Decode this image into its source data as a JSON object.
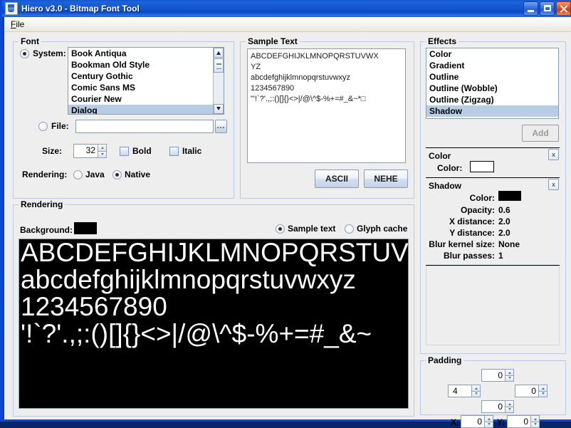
{
  "window": {
    "title": "Hiero v3.0 - Bitmap Font Tool",
    "icon": "java-cup-icon",
    "minimize_label": "",
    "maximize_label": "",
    "close_label": ""
  },
  "menubar": {
    "items": [
      {
        "label": "File",
        "mnemonic": "F"
      }
    ]
  },
  "font_panel": {
    "title": "Font",
    "system_label": "System:",
    "system_selected": true,
    "font_list": [
      "Book Antiqua",
      "Bookman Old Style",
      "Century Gothic",
      "Comic Sans MS",
      "Courier New",
      "Dialog"
    ],
    "font_selected": "Dialog",
    "file_label": "File:",
    "file_selected": false,
    "file_value": "",
    "browse_label": "...",
    "size_label": "Size:",
    "size_value": "32",
    "bold_label": "Bold",
    "bold_checked": false,
    "italic_label": "Italic",
    "italic_checked": false,
    "rendering_label": "Rendering:",
    "rendering_java_label": "Java",
    "rendering_native_label": "Native",
    "rendering_selected": "Native"
  },
  "sample_text_panel": {
    "title": "Sample Text",
    "value": "ABCDEFGHIJKLMNOPQRSTUVWXYZ\nabcdefghijklmnopqrstuvwxyz\n1234567890\n\"'!`?'.,;:()[]{}<>|/@\\^$-%+=#_&~*□",
    "lines": [
      "ABCDEFGHIJKLMNOPQRSTUVWX",
      "YZ",
      "abcdefghijklmnopqrstuvwxyz",
      "1234567890",
      "\"'!`?'.,;:()[]{}<>|/@\\^$-%+=#_&~*□"
    ],
    "ascii_button": "ASCII",
    "nehe_button": "NEHE"
  },
  "effects_panel": {
    "title": "Effects",
    "items": [
      "Color",
      "Gradient",
      "Outline",
      "Outline (Wobble)",
      "Outline (Zigzag)",
      "Shadow"
    ],
    "selected": "Shadow",
    "add_button": "Add",
    "add_enabled": false
  },
  "color_effect": {
    "title": "Color",
    "close_label": "x",
    "color_label": "Color:",
    "color_value": "#ffffff"
  },
  "shadow_effect": {
    "title": "Shadow",
    "close_label": "x",
    "rows": [
      {
        "label": "Color:",
        "value": "",
        "swatch": "#000000"
      },
      {
        "label": "Opacity:",
        "value": "0.6"
      },
      {
        "label": "X distance:",
        "value": "2.0"
      },
      {
        "label": "Y distance:",
        "value": "2.0"
      },
      {
        "label": "Blur kernel size:",
        "value": "None"
      },
      {
        "label": "Blur passes:",
        "value": "1"
      }
    ]
  },
  "rendering_panel": {
    "title": "Rendering",
    "background_label": "Background:",
    "background_color": "#000000",
    "sample_text_label": "Sample text",
    "glyph_cache_label": "Glyph cache",
    "view_selected": "Sample text",
    "preview_lines": [
      "ABCDEFGHIJKLMNOPQRSTUV",
      "abcdefghijklmnopqrstuvwxyz",
      "1234567890",
      "'!`?'.,;:()[]{}<>|/@\\^$-%+=#_&~"
    ]
  },
  "padding_panel": {
    "title": "Padding",
    "top": "0",
    "left": "4",
    "right": "0",
    "bottom": "0",
    "x_label": "X:",
    "x_value": "0",
    "y_label": "Y:",
    "y_value": "0"
  }
}
